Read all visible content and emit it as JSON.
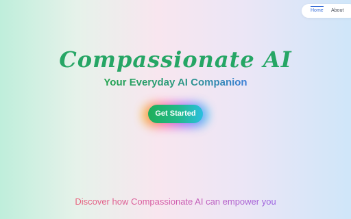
{
  "nav": {
    "items": [
      {
        "label": "Home",
        "active": true
      },
      {
        "label": "About",
        "active": false
      }
    ]
  },
  "hero": {
    "title": "Compassionate AI",
    "subtitle": "Your Everyday AI Companion",
    "cta_label": "Get Started"
  },
  "footer": {
    "tagline": "Discover how Compassionate AI can empower you"
  },
  "colors": {
    "accent_green": "#1fae5a",
    "accent_blue": "#2bbfe0",
    "nav_active": "#3b6fd8",
    "tagline_pink": "#e8607a",
    "tagline_purple": "#9a62e2"
  }
}
